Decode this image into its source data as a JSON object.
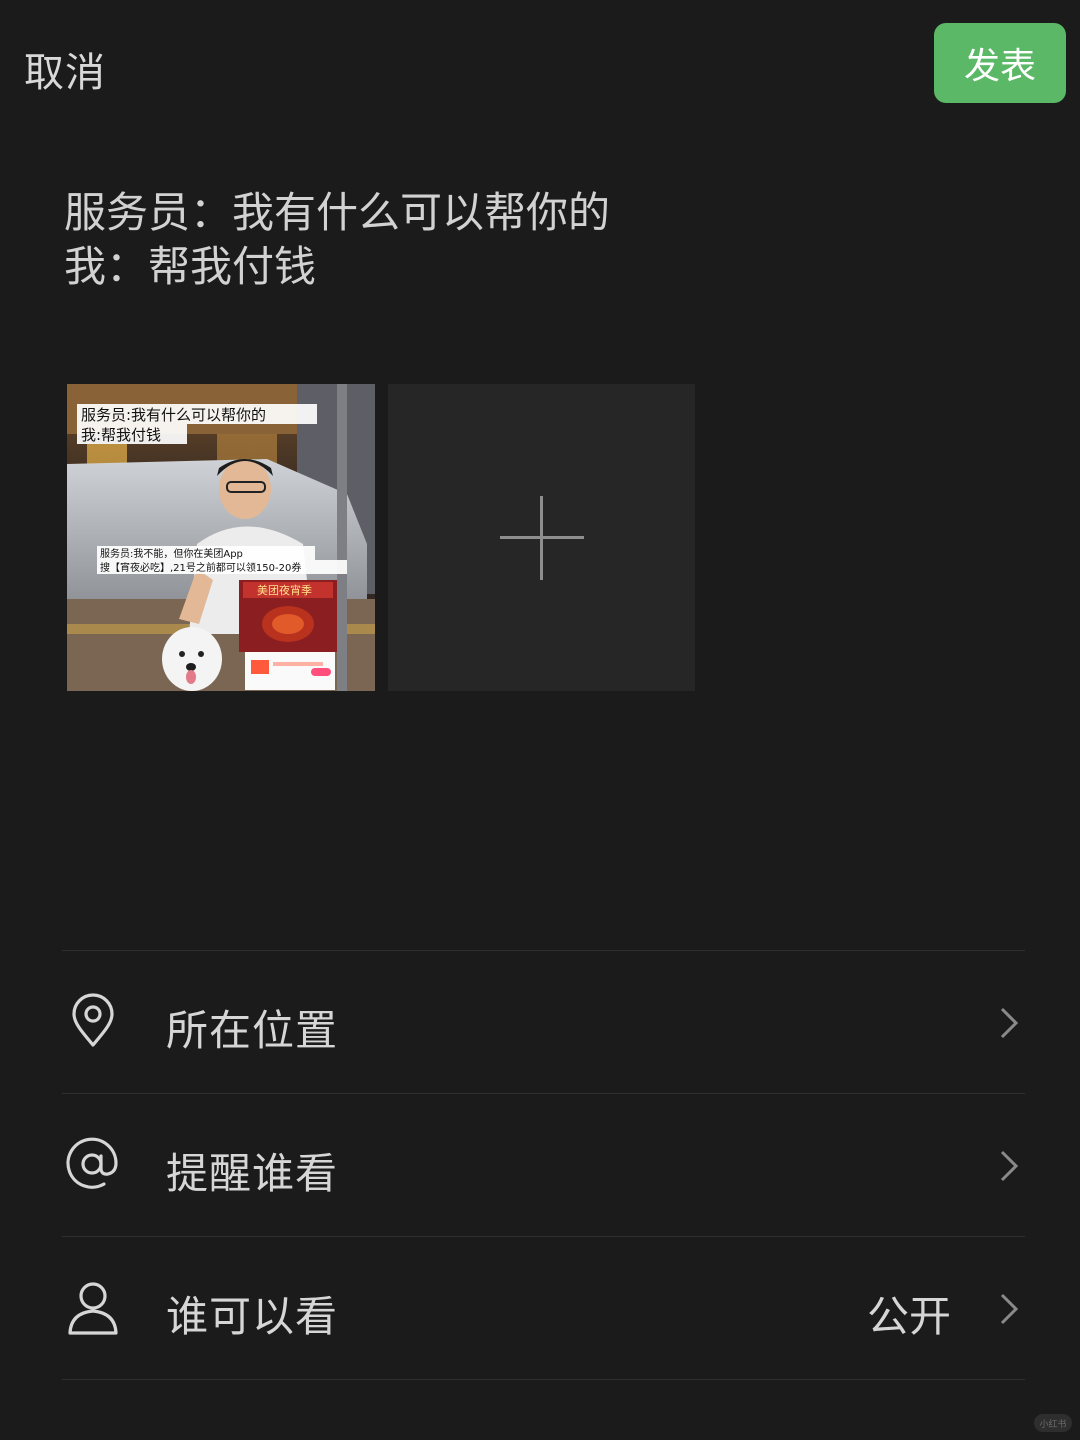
{
  "header": {
    "cancel_label": "取消",
    "publish_label": "发表",
    "publish_color": "#5bb866"
  },
  "post": {
    "lines": [
      "服务员：我有什么可以帮你的",
      "我：帮我付钱"
    ]
  },
  "photo": {
    "caption_line1": "服务员:我有什么可以帮你的",
    "caption_line2": "我:帮我付钱",
    "overlay_line1": "服务员:我不能，但你在美团App",
    "overlay_line2": "搜【宵夜必吃】,21号之前都可以领150-20券",
    "promo_title": "美团夜宵季"
  },
  "add_photo": {
    "icon": "plus-icon"
  },
  "options": [
    {
      "icon": "location-pin-icon",
      "label": "所在位置",
      "value": ""
    },
    {
      "icon": "at-sign-icon",
      "label": "提醒谁看",
      "value": ""
    },
    {
      "icon": "person-icon",
      "label": "谁可以看",
      "value": "公开"
    }
  ],
  "watermark": "小红书"
}
